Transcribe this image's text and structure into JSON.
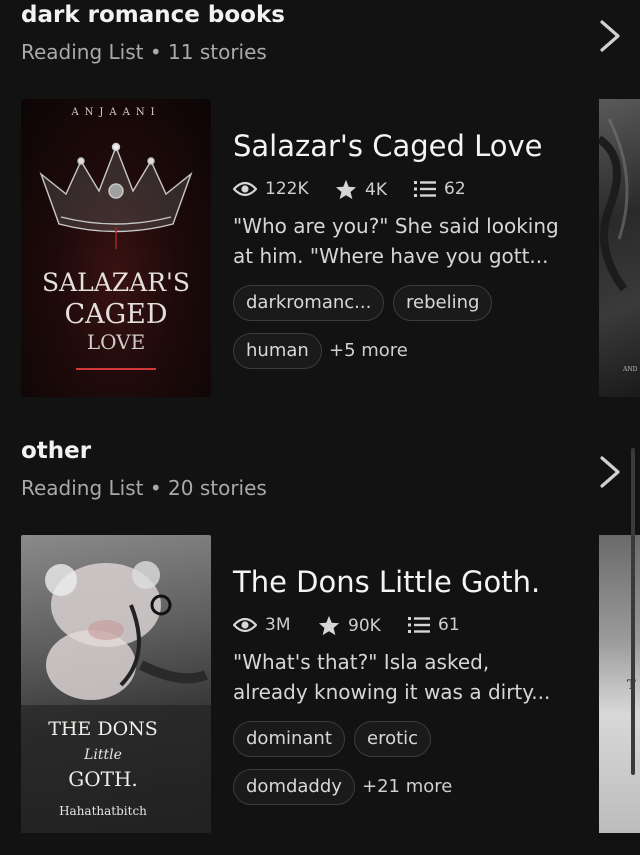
{
  "lists": [
    {
      "title": "dark romance books",
      "subtitle_type": "Reading List",
      "separator": "•",
      "story_count": "11 stories",
      "book": {
        "title": "Salazar's Caged Love",
        "reads": "122K",
        "votes": "4K",
        "parts": "62",
        "description_line1": "\"Who are you?\" She said looking",
        "description_line2": "at him.  \"Where have you gott...",
        "tags": [
          "darkromanc...",
          "rebeling",
          "human"
        ],
        "more_tags": "+5 more",
        "cover": {
          "author": "ANJAANI",
          "title_line1": "SALAZAR'S",
          "title_line2": "CAGED",
          "title_line3": "LOVE"
        },
        "peek_cover_text": "AND"
      }
    },
    {
      "title": "other",
      "subtitle_type": "Reading List",
      "separator": "•",
      "story_count": "20 stories",
      "book": {
        "title": "The Dons Little Goth.",
        "reads": "3M",
        "votes": "90K",
        "parts": "61",
        "description_line1": "\"What's that?\" Isla asked,",
        "description_line2": "already knowing it was a dirty...",
        "tags": [
          "dominant",
          "erotic",
          "domdaddy"
        ],
        "more_tags": "+21 more",
        "cover": {
          "title_line1": "THE DONS",
          "title_line2": "Little",
          "title_line3": "GOTH.",
          "author": "Hahathatbitch"
        },
        "peek_cover_text": "T"
      }
    }
  ],
  "icons": {
    "reads": "eye-icon",
    "votes": "star-icon",
    "parts": "list-icon",
    "next": "chevron-right-icon"
  }
}
